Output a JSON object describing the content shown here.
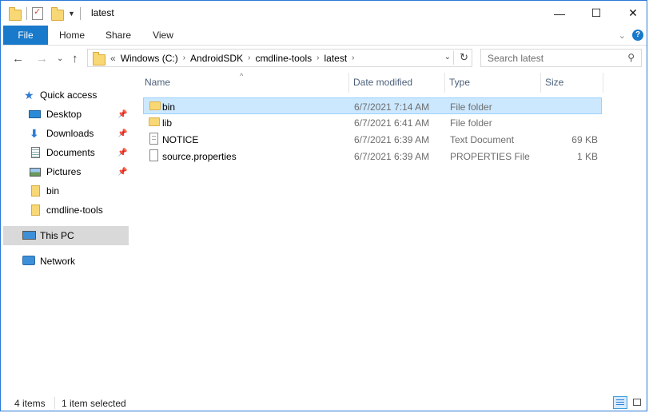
{
  "window": {
    "title": "latest",
    "controls": {
      "minimize": "—",
      "maximize": "☐",
      "close": "✕"
    }
  },
  "ribbon": {
    "tabs": [
      {
        "label": "File"
      },
      {
        "label": "Home"
      },
      {
        "label": "Share"
      },
      {
        "label": "View"
      }
    ]
  },
  "address": {
    "overflow": "«",
    "crumbs": [
      "Windows (C:)",
      "AndroidSDK",
      "cmdline-tools",
      "latest"
    ]
  },
  "search": {
    "placeholder": "Search latest"
  },
  "nav": {
    "quick_access": "Quick access",
    "pinned": [
      {
        "label": "Desktop",
        "icon": "desktop-icon"
      },
      {
        "label": "Downloads",
        "icon": "download-icon"
      },
      {
        "label": "Documents",
        "icon": "documents-icon"
      },
      {
        "label": "Pictures",
        "icon": "pictures-icon"
      }
    ],
    "recent": [
      {
        "label": "bin"
      },
      {
        "label": "cmdline-tools"
      }
    ],
    "this_pc": "This PC",
    "network": "Network"
  },
  "columns": {
    "name": "Name",
    "date": "Date modified",
    "type": "Type",
    "size": "Size"
  },
  "files": [
    {
      "name": "bin",
      "date": "6/7/2021 7:14 AM",
      "type": "File folder",
      "size": "",
      "icon": "folder-icon",
      "selected": true
    },
    {
      "name": "lib",
      "date": "6/7/2021 6:41 AM",
      "type": "File folder",
      "size": "",
      "icon": "folder-icon",
      "selected": false
    },
    {
      "name": "NOTICE",
      "date": "6/7/2021 6:39 AM",
      "type": "Text Document",
      "size": "69 KB",
      "icon": "text-file-icon",
      "selected": false
    },
    {
      "name": "source.properties",
      "date": "6/7/2021 6:39 AM",
      "type": "PROPERTIES File",
      "size": "1 KB",
      "icon": "file-icon",
      "selected": false
    }
  ],
  "status": {
    "count": "4 items",
    "selection": "1 item selected"
  },
  "colors": {
    "accent": "#1979ca",
    "selection": "#cce8ff",
    "folder": "#f8d775"
  }
}
